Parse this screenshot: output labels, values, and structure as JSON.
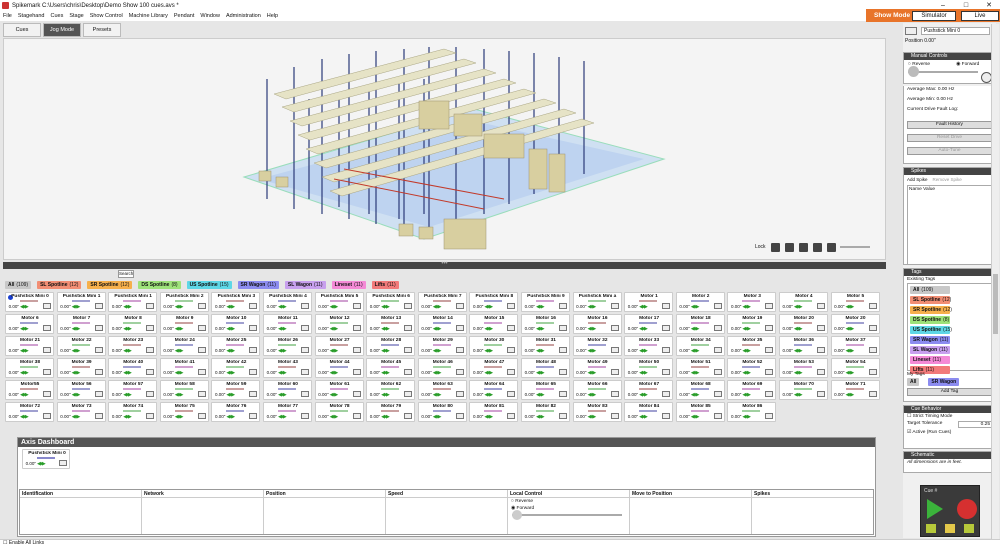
{
  "window": {
    "title": "Spikemark C:\\Users\\chris\\Desktop\\Demo Show 100 cues.avs *"
  },
  "menu": [
    "File",
    "Stagehand",
    "Cues",
    "Stage",
    "Show Control",
    "Machine Library",
    "Pendant",
    "Window",
    "Administration",
    "Help"
  ],
  "mode": {
    "label": "Show Mode",
    "simulator": "Simulator",
    "live": "Live"
  },
  "tabs": [
    "Cues",
    "Jog Mode",
    "Presets"
  ],
  "lock_label": "Lock",
  "search_label": "Search",
  "tags": [
    {
      "name": "All",
      "count": "(109)",
      "bg": "#c8c8c8"
    },
    {
      "name": "SL Spotline",
      "count": "(12)",
      "bg": "#f28e74"
    },
    {
      "name": "SR Spotline",
      "count": "(12)",
      "bg": "#f6b04c"
    },
    {
      "name": "DS Spotline",
      "count": "(8)",
      "bg": "#9ee27a"
    },
    {
      "name": "US Spotline",
      "count": "(15)",
      "bg": "#5ed7e6"
    },
    {
      "name": "SR Wagon",
      "count": "(11)",
      "bg": "#8c8cf0"
    },
    {
      "name": "SL Wagon",
      "count": "(11)",
      "bg": "#c8a0ee"
    },
    {
      "name": "Lineset",
      "count": "(11)",
      "bg": "#f48ad6"
    },
    {
      "name": "Lifts",
      "count": "(11)",
      "bg": "#f27a7a"
    }
  ],
  "motors": [
    "Pushstick Mini 0",
    "Pushstick Mini 1",
    "Pushstick Mini 1",
    "Pushstick Mini 2",
    "Pushstick Mini 3",
    "Pushstick Mini 4",
    "Pushstick Mini 5",
    "Pushstick Mini 6",
    "Pushstick Mini 7",
    "Pushstick Mini 8",
    "Pushstick Mini 9",
    "Pushstick Mini a",
    "Motor 1",
    "Motor 2",
    "Motor 3",
    "Motor 4",
    "Motor 5",
    "Motor 6",
    "Motor 7",
    "Motor 8",
    "Motor 9",
    "Motor 10",
    "Motor 11",
    "Motor 12",
    "Motor 13",
    "Motor 14",
    "Motor 15",
    "Motor 16",
    "Motor 16",
    "Motor 17",
    "Motor 18",
    "Motor 19",
    "Motor 20",
    "Motor 20",
    "Motor 21",
    "Motor 22",
    "Motor 23",
    "Motor 24",
    "Motor 25",
    "Motor 26",
    "Motor 27",
    "Motor 28",
    "Motor 29",
    "Motor 30",
    "Motor 31",
    "Motor 32",
    "Motor 33",
    "Motor 34",
    "Motor 35",
    "Motor 36",
    "Motor 37",
    "Motor 38",
    "Motor 39",
    "Motor 40",
    "Motor 41",
    "Motor 42",
    "Motor 43",
    "Motor 44",
    "Motor 45",
    "Motor 46",
    "Motor 47",
    "Motor 48",
    "Motor 49",
    "Motor 50",
    "Motor 51",
    "Motor 52",
    "Motor 53",
    "Motor 54",
    "Motor55",
    "Motor 56",
    "Motor 57",
    "Motor 58",
    "Motor 59",
    "Motor 60",
    "Motor 61",
    "Motor 62",
    "Motor 63",
    "Motor 64",
    "Motor 65",
    "Motor 66",
    "Motor 67",
    "Motor 68",
    "Motor 69",
    "Motor 70",
    "Motor 71",
    "Motor 72",
    "Motor 73",
    "Motor 74",
    "Motor 75",
    "Motor 76",
    "Motor 77",
    "Motor 78",
    "Motor 79",
    "Motor 80",
    "Motor 81",
    "Motor 82",
    "Motor 83",
    "Motor 84",
    "Motor 85",
    "Motor 86"
  ],
  "motor_value": "0.00\"",
  "axis_dashboard": {
    "title": "Axis Dashboard",
    "selected": "Pushstick Mini 0",
    "columns": [
      "Identification",
      "Network",
      "Position",
      "Speed",
      "Local Control",
      "Move to Position",
      "Spikes"
    ],
    "local_control": {
      "reverse": "Reverse",
      "forward": "Forward"
    }
  },
  "right_panel": {
    "axis_name": "Pushstick Mini 0",
    "position_label": "Position",
    "position_value": "0.00\"",
    "manual_controls": {
      "title": "Manual Controls",
      "reverse": "Reverse",
      "forward": "Forward"
    },
    "stats": [
      "Average Max: 0.00 Hz",
      "Average Min: 0.00 Hz",
      "Current Drive Fault Log:"
    ],
    "buttons": [
      "Fault History",
      "Reset Drive",
      "Auto-Tune"
    ],
    "spikes": {
      "title": "Spikes",
      "add": "Add Spike",
      "remove": "Remove Spike",
      "header": "Name Value"
    },
    "tags_section": {
      "title": "Tags",
      "existing": "Existing Tags",
      "my_tags": "My Tags",
      "add": "Add Tag",
      "my": [
        {
          "name": "All",
          "bg": "#c8c8c8"
        },
        {
          "name": "SR Wagon",
          "bg": "#8c8cf0"
        }
      ]
    },
    "cue_behavior": {
      "title": "Cue Behavior",
      "strict": "Strict Timing Mode",
      "tolerance_label": "Target Tolerance",
      "tolerance_value": "0.25",
      "active": "Active (Run Cues)"
    },
    "schematic": {
      "title": "Schematic",
      "note": "All dimensions are in feet."
    }
  },
  "cue_box": {
    "label": "Cue #"
  },
  "status": {
    "enable_links": "Enable All Links"
  }
}
